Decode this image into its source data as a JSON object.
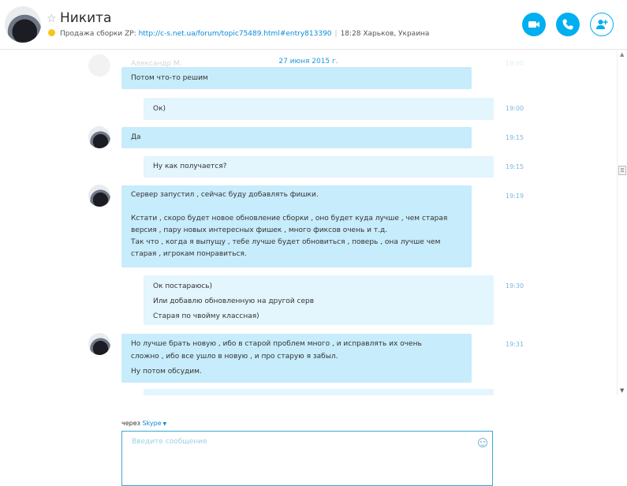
{
  "header": {
    "contact_name": "Никита",
    "mood_text": "Продажа сборки ZP: ",
    "mood_link": "http://c-s.net.ua/forum/topic75489.html#entry813390",
    "local_time": "18:28 Харьков, Украина",
    "separator": "|"
  },
  "conversation": {
    "date_banner": "27 июня 2015 г.",
    "faded_name": "Александр М.",
    "faded_time": "19:00",
    "messages": [
      {
        "from": "them",
        "lines": [
          "Потом что-то решим"
        ],
        "time": ""
      },
      {
        "from": "me",
        "lines": [
          "Ок)"
        ],
        "time": "19:00"
      },
      {
        "from": "them",
        "lines": [
          "Да"
        ],
        "time": "19:15"
      },
      {
        "from": "me",
        "lines": [
          "Ну как получается?"
        ],
        "time": "19:15"
      },
      {
        "from": "them",
        "lines": [
          "Сервер запустил , сейчас буду добавлять фишки.",
          "",
          "Кстати , скоро будет новое обновление сборки , оно будет куда лучше , чем старая",
          "версия , пару новых интересных фишек , много фиксов очень и т.д.",
          "Так что , когда я выпущу , тебе лучше будет обновиться , поверь , она лучше чем",
          "старая , игрокам понравиться."
        ],
        "time": "19:19"
      },
      {
        "from": "me",
        "lines": [
          "Ок постараюсь)",
          "Или добавлю обновленную на другой серв",
          "Старая по чвойму классная)"
        ],
        "time": "19:30"
      },
      {
        "from": "them",
        "lines": [
          "Но лучше брать новую , ибо в старой проблем много , и исправлять их очень",
          "сложно , ибо все ушло в новую , и про старую я забыл.",
          "Ну потом обсудим."
        ],
        "time": "19:31"
      }
    ]
  },
  "compose": {
    "via_prefix": "через",
    "via_service": "Skype",
    "placeholder": "Введите сообщение"
  },
  "icons": {
    "video": "video-call-icon",
    "call": "phone-icon",
    "add": "add-contact-icon",
    "emoticon": "emoticon-icon"
  },
  "colors": {
    "accent": "#00aff0",
    "their_bubble": "#c7ecfb",
    "my_bubble": "#e3f5fd",
    "mood_dot": "#f7c51b"
  }
}
